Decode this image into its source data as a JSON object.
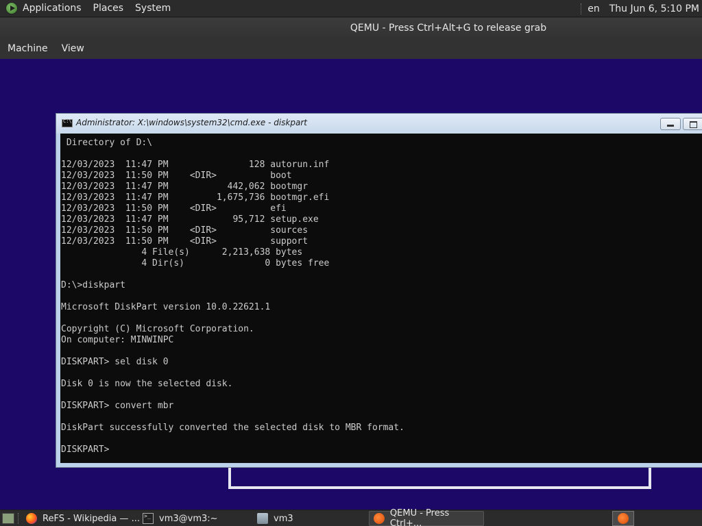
{
  "top_panel": {
    "menus": [
      "Applications",
      "Places",
      "System"
    ],
    "language": "en",
    "clock": "Thu Jun  6,  5:10 PM"
  },
  "qemu": {
    "title": "QEMU - Press Ctrl+Alt+G to release grab",
    "menu": [
      "Machine",
      "View"
    ]
  },
  "cmd_window": {
    "title": "Administrator: X:\\windows\\system32\\cmd.exe - diskpart",
    "lines": [
      " Directory of D:\\",
      "",
      "12/03/2023  11:47 PM               128 autorun.inf",
      "12/03/2023  11:50 PM    <DIR>          boot",
      "12/03/2023  11:47 PM           442,062 bootmgr",
      "12/03/2023  11:47 PM         1,675,736 bootmgr.efi",
      "12/03/2023  11:50 PM    <DIR>          efi",
      "12/03/2023  11:47 PM            95,712 setup.exe",
      "12/03/2023  11:50 PM    <DIR>          sources",
      "12/03/2023  11:50 PM    <DIR>          support",
      "               4 File(s)      2,213,638 bytes",
      "               4 Dir(s)               0 bytes free",
      "",
      "D:\\>diskpart",
      "",
      "Microsoft DiskPart version 10.0.22621.1",
      "",
      "Copyright (C) Microsoft Corporation.",
      "On computer: MINWINPC",
      "",
      "DISKPART> sel disk 0",
      "",
      "Disk 0 is now the selected disk.",
      "",
      "DISKPART> convert mbr",
      "",
      "DiskPart successfully converted the selected disk to MBR format.",
      "",
      "DISKPART>"
    ]
  },
  "taskbar": {
    "tasks": [
      {
        "label": "ReFS - Wikipedia — ...",
        "icon": "firefox-icon"
      },
      {
        "label": "vm3@vm3:~",
        "icon": "terminal-icon"
      },
      {
        "label": "vm3",
        "icon": "folder-icon"
      },
      {
        "label": "QEMU - Press Ctrl+...",
        "icon": "qemu-icon"
      }
    ]
  }
}
